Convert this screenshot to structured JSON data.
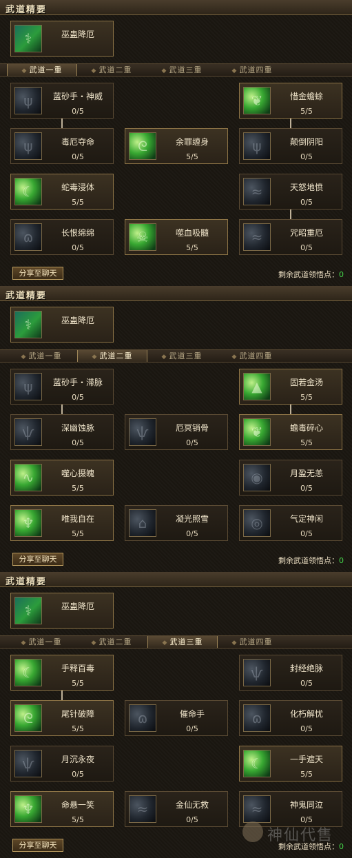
{
  "panels": [
    {
      "header": "武道精要",
      "core": {
        "name": "巫蛊降厄",
        "icon": "serpent-emblem-icon"
      },
      "tabs": [
        "武道一重",
        "武道二重",
        "武道三重",
        "武道四重"
      ],
      "active_tab": 0,
      "skills": [
        {
          "name": "蓝砂手・神威",
          "level": "0/5",
          "icon": "dark-claw-icon"
        },
        {
          "name": "惜金蟾蜍",
          "level": "5/5",
          "icon": "toad-icon"
        },
        {
          "name": "毒厄夺命",
          "level": "0/5",
          "icon": "dark-claw-icon"
        },
        {
          "name": "余罪缠身",
          "level": "5/5",
          "icon": "green-coil-icon"
        },
        {
          "name": "颠倒阴阳",
          "level": "0/5",
          "icon": "dark-claw-icon"
        },
        {
          "name": "蛇毒浸体",
          "level": "5/5",
          "icon": "green-moon-icon"
        },
        {
          "name": "天怒地愤",
          "level": "0/5",
          "icon": "blue-wave-icon"
        },
        {
          "name": "长恨绵绵",
          "level": "0/5",
          "icon": "dark-swirl-icon"
        },
        {
          "name": "噬血吸髓",
          "level": "5/5",
          "icon": "green-skull-icon"
        },
        {
          "name": "咒昭重厄",
          "level": "0/5",
          "icon": "blue-wave-icon"
        }
      ],
      "share": "分享至聊天",
      "points_label": "剩余武道领悟点：",
      "points": "0"
    },
    {
      "header": "武道精要",
      "core": {
        "name": "巫蛊降厄",
        "icon": "serpent-emblem-icon"
      },
      "tabs": [
        "武道一重",
        "武道二重",
        "武道三重",
        "武道四重"
      ],
      "active_tab": 1,
      "skills": [
        {
          "name": "蓝砂手・滞脉",
          "level": "0/5",
          "icon": "dark-claw-icon"
        },
        {
          "name": "固若金汤",
          "level": "5/5",
          "icon": "green-mound-icon"
        },
        {
          "name": "深幽蚀脉",
          "level": "0/5",
          "icon": "dark-beast-icon"
        },
        {
          "name": "厄冥销骨",
          "level": "0/5",
          "icon": "dark-beast-icon"
        },
        {
          "name": "蟾毒碎心",
          "level": "5/5",
          "icon": "toad-icon"
        },
        {
          "name": "噬心摄魄",
          "level": "5/5",
          "icon": "green-wave-icon"
        },
        {
          "name": "月盈无恙",
          "level": "0/5",
          "icon": "blue-mask-icon"
        },
        {
          "name": "唯我自在",
          "level": "5/5",
          "icon": "golden-figure-icon"
        },
        {
          "name": "凝光照雪",
          "level": "0/5",
          "icon": "dark-ruin-icon"
        },
        {
          "name": "气定神闲",
          "level": "0/5",
          "icon": "dark-ring-icon"
        }
      ],
      "share": "分享至聊天",
      "points_label": "剩余武道领悟点：",
      "points": "0"
    },
    {
      "header": "武道精要",
      "core": {
        "name": "巫蛊降厄",
        "icon": "serpent-emblem-icon"
      },
      "tabs": [
        "武道一重",
        "武道二重",
        "武道三重",
        "武道四重"
      ],
      "active_tab": 2,
      "skills": [
        {
          "name": "手释百毒",
          "level": "5/5",
          "icon": "green-moon-icon"
        },
        {
          "name": "封经绝脉",
          "level": "0/5",
          "icon": "dark-beast-icon"
        },
        {
          "name": "尾针破障",
          "level": "5/5",
          "icon": "green-coil-icon"
        },
        {
          "name": "催命手",
          "level": "0/5",
          "icon": "dark-swirl-icon"
        },
        {
          "name": "化朽解忧",
          "level": "0/5",
          "icon": "dark-swirl-icon"
        },
        {
          "name": "月沉永夜",
          "level": "0/5",
          "icon": "dark-beast-icon"
        },
        {
          "name": "一手遮天",
          "level": "5/5",
          "icon": "green-moon-icon"
        },
        {
          "name": "命悬一笑",
          "level": "5/5",
          "icon": "green-figure-icon"
        },
        {
          "name": "金仙无救",
          "level": "0/5",
          "icon": "blue-wave-icon"
        },
        {
          "name": "神鬼同泣",
          "level": "0/5",
          "icon": "blue-wave-icon"
        }
      ],
      "share": "分享至聊天",
      "points_label": "剩余武道领悟点：",
      "points": "0"
    }
  ],
  "watermark": "神仙代售"
}
